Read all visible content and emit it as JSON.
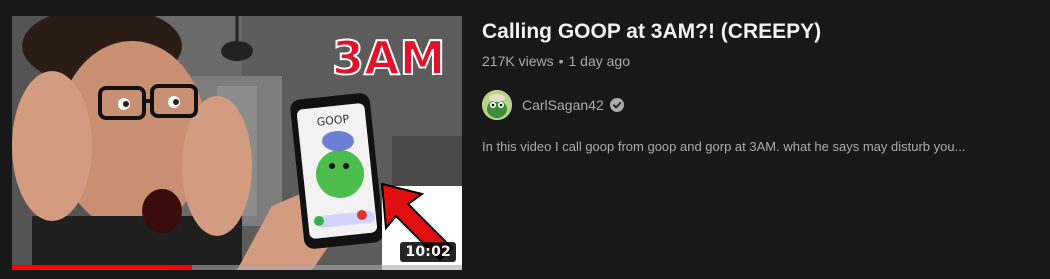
{
  "video": {
    "title": "Calling GOOP at 3AM?! (CREEPY)",
    "views": "217K views",
    "separator": "•",
    "age": "1 day ago",
    "duration": "10:02",
    "watch_progress": 0.4,
    "thumbnail_text": "3AM",
    "phone_label": "GOOP",
    "description": "In this video I call goop from goop and gorp at 3AM. what he says may disturb you..."
  },
  "channel": {
    "name": "CarlSagan42",
    "verified_icon": "verified-checkmark-icon"
  },
  "colors": {
    "background": "#181818",
    "title": "#f1f1f1",
    "secondary": "#aaaaaa",
    "progress": "#ff0000",
    "thumb_text": "#e2102a"
  }
}
